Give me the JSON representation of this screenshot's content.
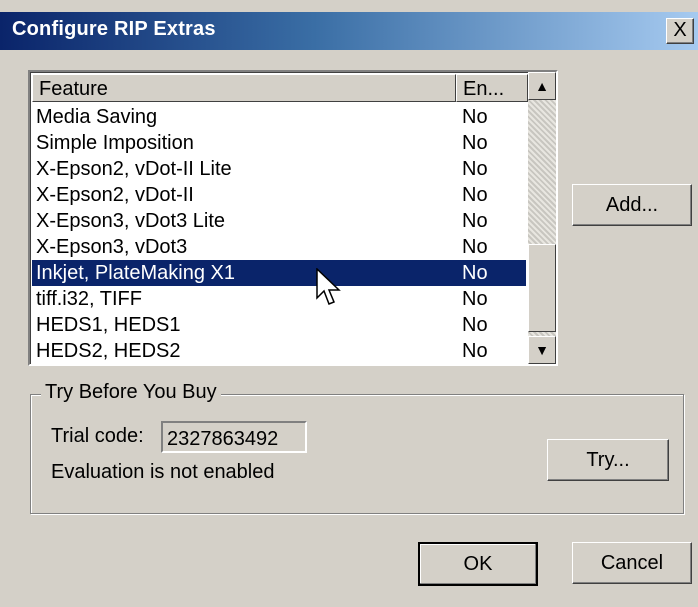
{
  "window": {
    "title": "Configure RIP Extras",
    "close_label": "X"
  },
  "features": {
    "columns": [
      "Feature",
      "En..."
    ],
    "rows": [
      {
        "feature": "Media Saving",
        "enabled": "No"
      },
      {
        "feature": "Simple Imposition",
        "enabled": "No"
      },
      {
        "feature": "X-Epson2, vDot-II Lite",
        "enabled": "No"
      },
      {
        "feature": "X-Epson2, vDot-II",
        "enabled": "No"
      },
      {
        "feature": "X-Epson3, vDot3 Lite",
        "enabled": "No"
      },
      {
        "feature": "X-Epson3, vDot3",
        "enabled": "No"
      },
      {
        "feature": "Inkjet, PlateMaking X1",
        "enabled": "No",
        "selected": true
      },
      {
        "feature": "tiff.i32, TIFF",
        "enabled": "No"
      },
      {
        "feature": "HEDS1, HEDS1",
        "enabled": "No"
      },
      {
        "feature": "HEDS2, HEDS2",
        "enabled": "No"
      }
    ]
  },
  "buttons": {
    "add": "Add...",
    "try": "Try...",
    "ok": "OK",
    "cancel": "Cancel"
  },
  "trial": {
    "group_label": "Try Before You Buy",
    "code_label": "Trial code:",
    "code_value": "2327863492",
    "status": "Evaluation is not enabled"
  },
  "colors": {
    "title_bar": "#0a246a",
    "selection": "#0a246a",
    "dialog_face": "#d4d0c8"
  }
}
